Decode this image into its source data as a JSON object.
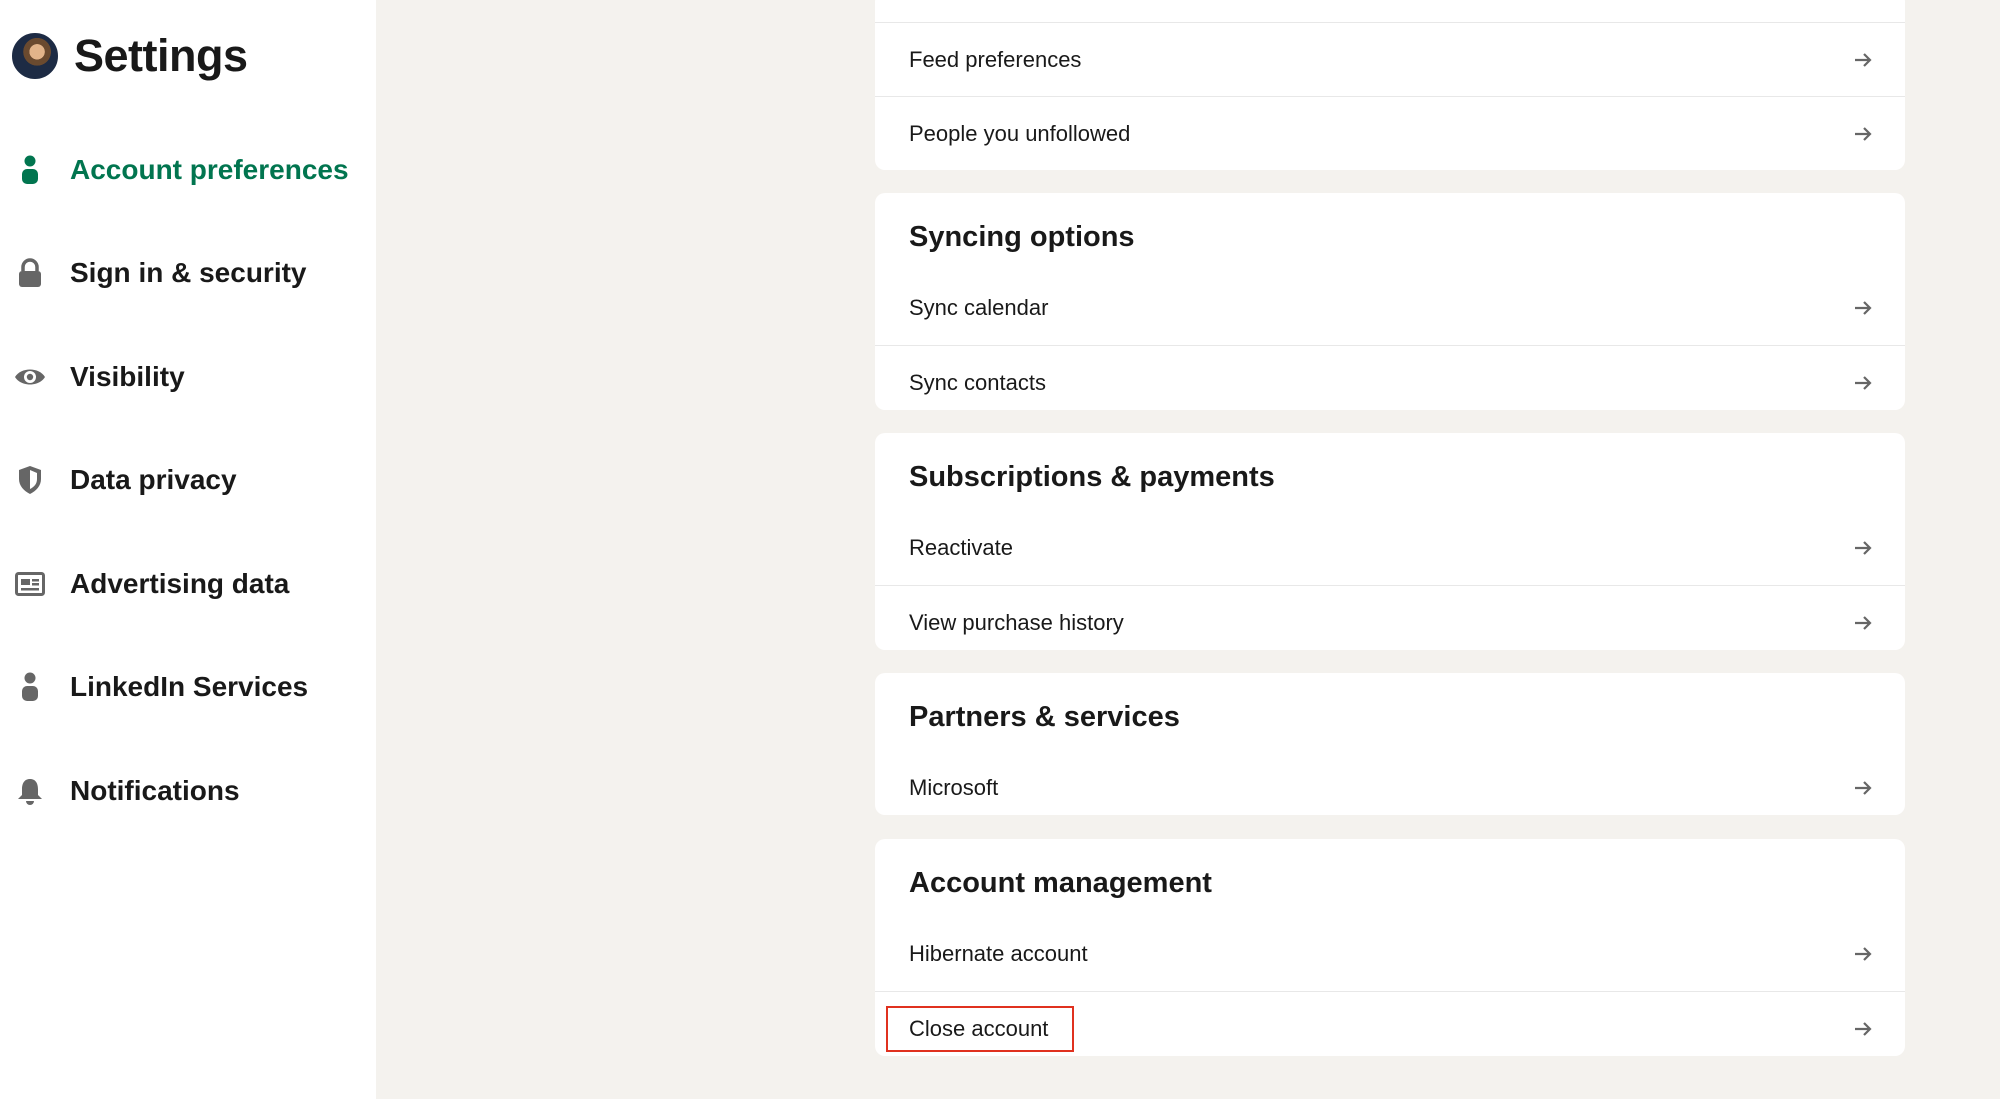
{
  "sidebar": {
    "title": "Settings",
    "items": [
      {
        "label": "Account preferences",
        "icon": "person-icon",
        "active": true
      },
      {
        "label": "Sign in & security",
        "icon": "lock-icon"
      },
      {
        "label": "Visibility",
        "icon": "eye-icon"
      },
      {
        "label": "Data privacy",
        "icon": "shield-icon"
      },
      {
        "label": "Advertising data",
        "icon": "ad-card-icon"
      },
      {
        "label": "LinkedIn Services",
        "icon": "person-icon"
      },
      {
        "label": "Notifications",
        "icon": "bell-icon"
      }
    ]
  },
  "sections": [
    {
      "title": "",
      "rows": [
        "Feed preferences",
        "People you unfollowed"
      ]
    },
    {
      "title": "Syncing options",
      "rows": [
        "Sync calendar",
        "Sync contacts"
      ]
    },
    {
      "title": "Subscriptions & payments",
      "rows": [
        "Reactivate",
        "View purchase history"
      ]
    },
    {
      "title": "Partners & services",
      "rows": [
        "Microsoft"
      ]
    },
    {
      "title": "Account management",
      "rows": [
        "Hibernate account",
        "Close account"
      ]
    }
  ],
  "colors": {
    "active_green": "#01754f",
    "page_bg": "#f4f2ee",
    "highlight_red": "#e0311f",
    "icon_gray": "#666666"
  }
}
